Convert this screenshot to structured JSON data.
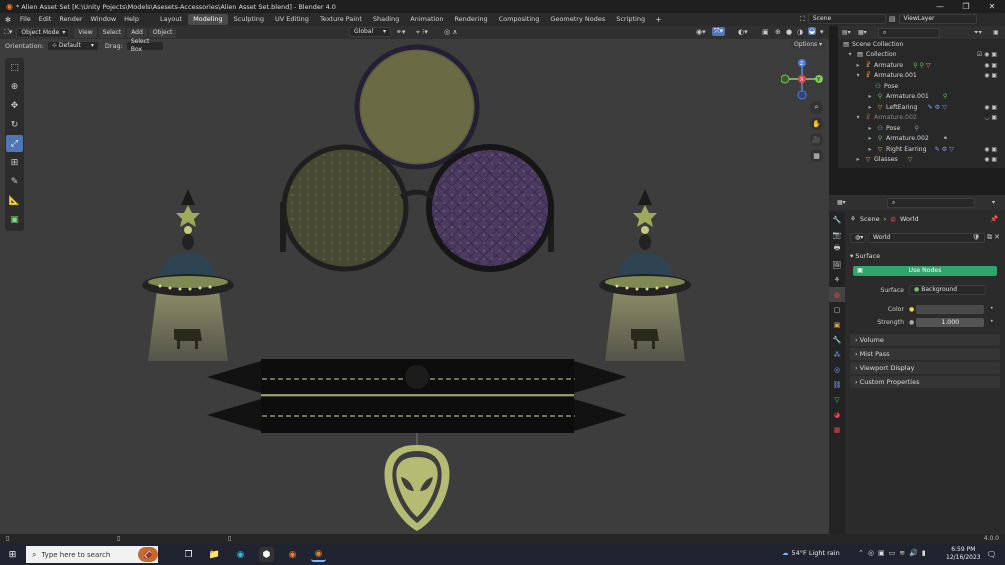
{
  "window": {
    "title": "* Alien Asset Set [K:\\Unity Pojects\\Models\\Asesets-Accessories\\Alien Asset Set.blend] - Blender 4.0"
  },
  "menus": [
    "File",
    "Edit",
    "Render",
    "Window",
    "Help"
  ],
  "workspaces": [
    "Layout",
    "Modeling",
    "Sculpting",
    "UV Editing",
    "Texture Paint",
    "Shading",
    "Animation",
    "Rendering",
    "Compositing",
    "Geometry Nodes",
    "Scripting"
  ],
  "active_workspace": "Modeling",
  "scene": {
    "name": "Scene",
    "view_layer": "ViewLayer"
  },
  "viewport_header": {
    "mode": "Object Mode",
    "view": "View",
    "select": "Select",
    "add": "Add",
    "object": "Object",
    "transform": "Global",
    "options": "Options"
  },
  "viewport_sub": {
    "orientation_label": "Orientation:",
    "orientation": "Default",
    "drag_label": "Drag:",
    "drag": "Select Box"
  },
  "gizmo": {
    "x": "X",
    "y": "Y",
    "z": "Z"
  },
  "outliner": {
    "rows": [
      {
        "label": "Scene Collection",
        "icon": "collection-icon"
      },
      {
        "label": "Collection",
        "icon": "collection-icon"
      },
      {
        "label": "Armature",
        "icon": "armature-icon"
      },
      {
        "label": "Armature.001",
        "icon": "armature-icon"
      },
      {
        "label": "Pose",
        "icon": "pose-icon"
      },
      {
        "label": "Armature.001",
        "icon": "armature-data-icon"
      },
      {
        "label": "LeftEaring",
        "icon": "mesh-icon"
      },
      {
        "label": "Armature.002",
        "icon": "armature-icon"
      },
      {
        "label": "Pose",
        "icon": "pose-icon"
      },
      {
        "label": "Armature.002",
        "icon": "armature-data-icon"
      },
      {
        "label": "Right Earring",
        "icon": "mesh-icon"
      },
      {
        "label": "Glasses",
        "icon": "mesh-icon"
      }
    ]
  },
  "properties": {
    "breadcrumb": {
      "scene": "Scene",
      "world": "World"
    },
    "world_name": "World",
    "surface_panel": "Surface",
    "use_nodes": "Use Nodes",
    "surface_label": "Surface",
    "surface_value": "Background",
    "color_label": "Color",
    "strength_label": "Strength",
    "strength_value": "1.000",
    "panels": [
      "Volume",
      "Mist Pass",
      "Viewport Display",
      "Custom Properties"
    ]
  },
  "statusbar": {
    "version": "4.0.0"
  },
  "taskbar": {
    "search_placeholder": "Type here to search",
    "weather": "54°F  Light rain",
    "time": "6:59 PM",
    "date": "12/16/2023"
  },
  "colors": {
    "accent_blue": "#4e77b8",
    "green": "#2fa46b",
    "olive": "#9ea95a",
    "purple": "#6b4e8a"
  }
}
